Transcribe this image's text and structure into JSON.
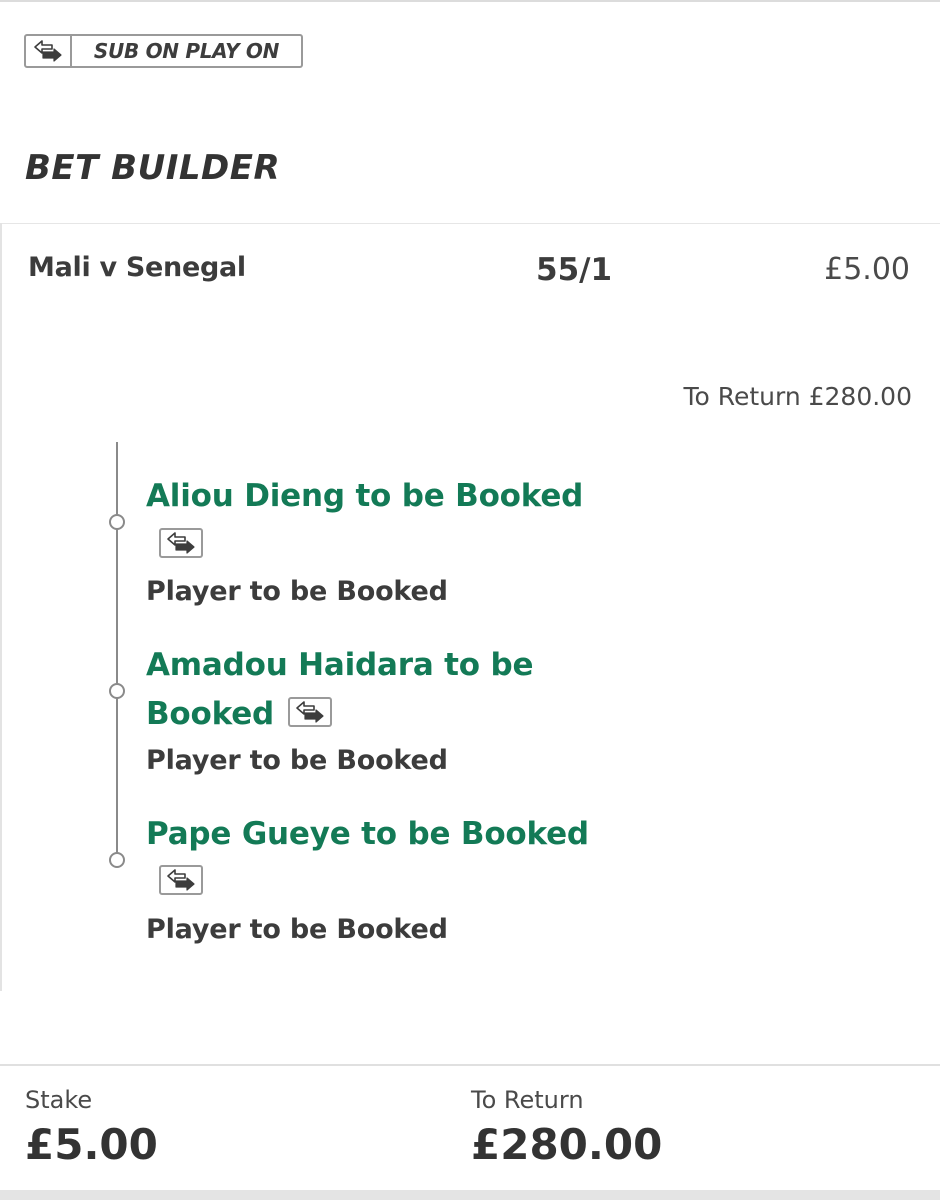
{
  "badge": {
    "label": "SUB ON PLAY ON",
    "icon": "swap-arrows-icon"
  },
  "section_title": "BET BUILDER",
  "bet": {
    "match": "Mali v Senegal",
    "odds": "55/1",
    "stake": "£5.00",
    "to_return": "To Return £280.00"
  },
  "selections": [
    {
      "title": "Aliou Dieng to be Booked",
      "market": "Player to be Booked"
    },
    {
      "title_line1": "Amadou Haidara to be",
      "title_line2": "Booked",
      "market": "Player to be Booked"
    },
    {
      "title": "Pape Gueye to be Booked",
      "market": "Player to be Booked"
    }
  ],
  "footer": {
    "stake_label": "Stake",
    "stake_value": "£5.00",
    "return_label": "To Return",
    "return_value": "£280.00"
  },
  "colors": {
    "selection_green": "#137a56",
    "text_dark": "#333333",
    "border_grey": "#9a9a9a"
  }
}
